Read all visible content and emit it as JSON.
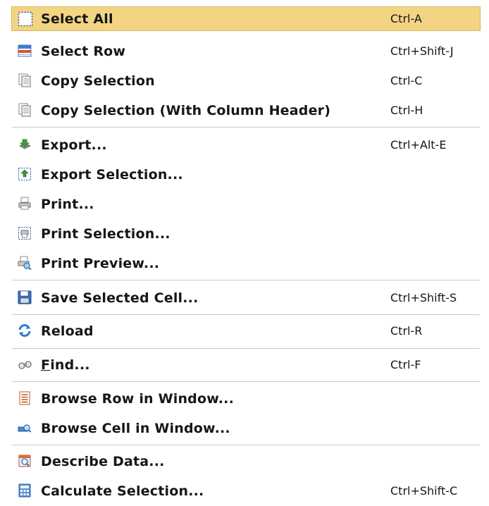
{
  "menu": {
    "items": [
      {
        "label": "Select All",
        "shortcut": "Ctrl-A",
        "icon": "select-all-icon"
      },
      {
        "label": "Select Row",
        "shortcut": "Ctrl+Shift-J",
        "icon": "select-row-icon"
      },
      {
        "label": "Copy Selection",
        "shortcut": "Ctrl-C",
        "icon": "copy-icon"
      },
      {
        "label": "Copy Selection (With Column Header)",
        "shortcut": "Ctrl-H",
        "icon": "copy-icon"
      },
      {
        "label": "Export...",
        "shortcut": "Ctrl+Alt-E",
        "icon": "export-icon"
      },
      {
        "label": "Export Selection...",
        "shortcut": "",
        "icon": "export-selection-icon"
      },
      {
        "label": "Print...",
        "shortcut": "",
        "icon": "printer-icon"
      },
      {
        "label": "Print Selection...",
        "shortcut": "",
        "icon": "print-selection-icon"
      },
      {
        "label": "Print Preview...",
        "shortcut": "",
        "icon": "print-preview-icon"
      },
      {
        "label": "Save Selected Cell...",
        "shortcut": "Ctrl+Shift-S",
        "icon": "save-icon"
      },
      {
        "label": "Reload",
        "shortcut": "Ctrl-R",
        "icon": "reload-icon"
      },
      {
        "label_mnemonic": "F",
        "label_rest": "ind...",
        "shortcut": "Ctrl-F",
        "icon": "binoculars-icon"
      },
      {
        "label": "Browse Row in Window...",
        "shortcut": "",
        "icon": "browse-row-icon"
      },
      {
        "label": "Browse Cell in Window...",
        "shortcut": "",
        "icon": "browse-cell-icon"
      },
      {
        "label": "Describe Data...",
        "shortcut": "",
        "icon": "describe-data-icon"
      },
      {
        "label": "Calculate Selection...",
        "shortcut": "Ctrl+Shift-C",
        "icon": "calculator-icon"
      }
    ]
  },
  "colors": {
    "highlight": "#f3d483",
    "separator": "#c9c9c9"
  }
}
